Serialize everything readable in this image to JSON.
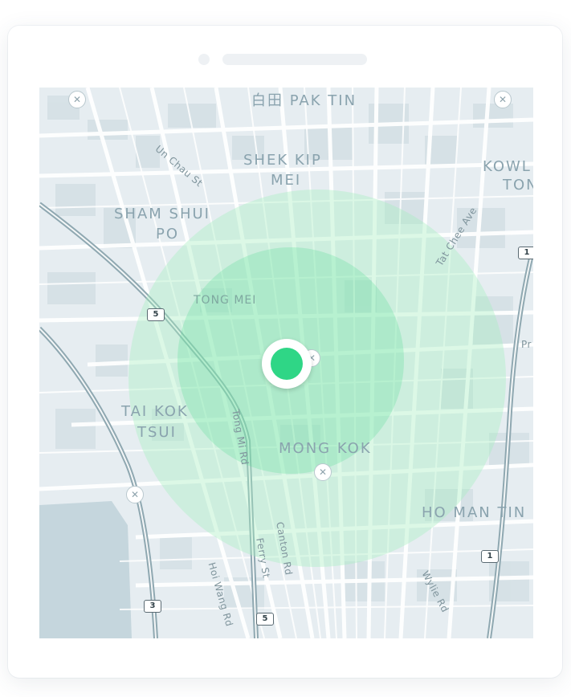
{
  "map": {
    "district_labels": [
      {
        "text": "白田 PAK TIN"
      },
      {
        "text": "SHEK KIP"
      },
      {
        "text": "MEI"
      },
      {
        "text": "SHAM SHUI"
      },
      {
        "text": "PO"
      },
      {
        "text": "KOWL"
      },
      {
        "text": "TON"
      },
      {
        "text": "TONG MEI"
      },
      {
        "text": "TAI KOK"
      },
      {
        "text": "TSUI"
      },
      {
        "text": "MONG KOK"
      },
      {
        "text": "HO MAN TIN"
      },
      {
        "text": "Pr"
      }
    ],
    "street_labels": [
      {
        "text": "Un Chau St"
      },
      {
        "text": "Tat Chee Ave"
      },
      {
        "text": "Tong Mi Rd"
      },
      {
        "text": "Canton Rd"
      },
      {
        "text": "Ferry St"
      },
      {
        "text": "Hoi Wang Rd"
      },
      {
        "text": "Wylie Rd"
      }
    ],
    "route_shields": [
      "5",
      "5",
      "3",
      "1",
      "1"
    ],
    "station_icon": "mtr-station-icon",
    "location_marker": {
      "color": "#2fd686",
      "ring_color": "#ffffff"
    },
    "radius_colors": {
      "outer": "#a5eec1",
      "inner": "#5ade96"
    }
  }
}
